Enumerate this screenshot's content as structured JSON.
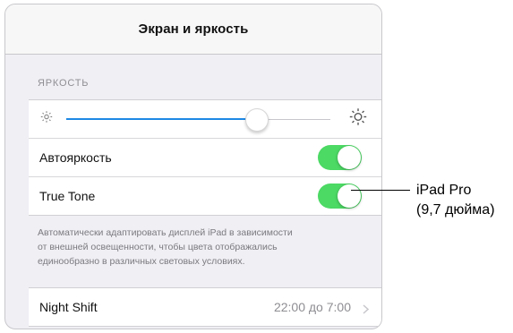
{
  "nav": {
    "title": "Экран и яркость"
  },
  "brightness": {
    "section_header": "ЯРКОСТЬ",
    "slider_value": 0.72,
    "min_icon": "sun-small-icon",
    "max_icon": "sun-large-icon"
  },
  "rows": {
    "auto_brightness": {
      "label": "Автояркость",
      "on": true
    },
    "true_tone": {
      "label": "True Tone",
      "on": true
    }
  },
  "footer": {
    "lines": [
      "Автоматически адаптировать дисплей iPad в зависимости",
      "от внешней освещенности, чтобы цвета отображались",
      "единообразно в различных световых условиях."
    ]
  },
  "night_shift": {
    "label": "Night Shift",
    "value": "22:00 до 7:00",
    "icon": "chevron-right-icon"
  },
  "callout": {
    "line1": "iPad Pro",
    "line2": "(9,7 дюйма)"
  },
  "colors": {
    "toggle_on": "#4cd964",
    "slider_fill": "#1e88e5"
  }
}
